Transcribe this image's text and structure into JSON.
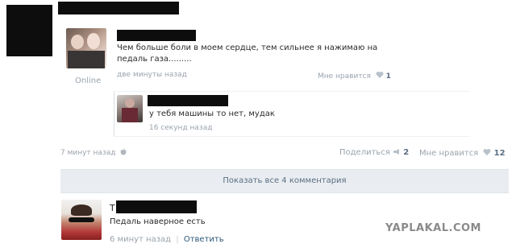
{
  "post": {
    "online_label": "Online",
    "comment1": {
      "text": "Чем больше боли в моем сердце, тем сильнее я нажимаю на педаль газа.........",
      "time": "две минуты назад",
      "like_label": "Мне нравится",
      "like_count": "1"
    },
    "reply": {
      "text": "у тебя машины то нет, мудак",
      "time": "16 секунд назад"
    },
    "footer": {
      "time": "7 минут назад",
      "share_label": "Поделиться",
      "share_count": "2",
      "like_label": "Мне нравится",
      "like_count": "12"
    },
    "show_all_button": "Показать все 4 комментария",
    "comment2": {
      "initial": "Т",
      "text": "Педаль наверное есть",
      "time": "6 минут назад",
      "separator": "|",
      "reply_label": "Ответить"
    }
  },
  "watermark": "YAPLAKAL.COM",
  "colors": {
    "link": "#2b587a",
    "muted": "#9aa3ad",
    "bar_bg": "#e9edf1",
    "watermark": "#8a8a8a"
  }
}
